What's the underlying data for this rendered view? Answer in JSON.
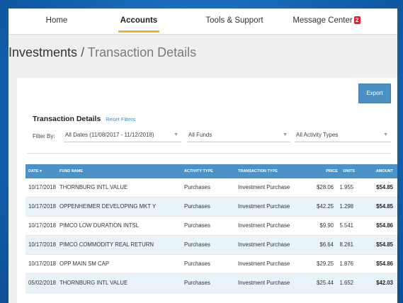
{
  "nav": {
    "items": [
      {
        "label": "Home"
      },
      {
        "label": "Accounts"
      },
      {
        "label": "Tools & Support"
      },
      {
        "label": "Message Center"
      }
    ],
    "message_badge": "2"
  },
  "heading": {
    "section": "Investments",
    "separator": "/",
    "current": "Transaction Details"
  },
  "card": {
    "export_label": "Export",
    "title": "Transaction Details",
    "reset_label": "Reset Filters",
    "filter_label": "Filter By:",
    "filters": {
      "dates": "All Dates (11/08/2017 - 11/12/2018)",
      "funds": "All Funds",
      "activity": "All Activity Types"
    }
  },
  "table": {
    "headers": {
      "date": "DATE",
      "fund": "FUND NAME",
      "activity": "ACTIVITY TYPE",
      "type": "TRANSACTION TYPE",
      "price": "PRICE",
      "units": "UNITS",
      "amount": "AMOUNT"
    },
    "rows": [
      {
        "date": "10/17/2018",
        "fund": "THORNBURG INTL VALUE",
        "activity": "Purchases",
        "type": "Investment Purchase",
        "price": "$28.06",
        "units": "1.955",
        "amount": "$54.85"
      },
      {
        "date": "10/17/2018",
        "fund": "OPPENHEIMER DEVELOPING MKT Y",
        "activity": "Purchases",
        "type": "Investment Purchase",
        "price": "$42.25",
        "units": "1.298",
        "amount": "$54.85"
      },
      {
        "date": "10/17/2018",
        "fund": "PIMCO LOW DURATION INTSL",
        "activity": "Purchases",
        "type": "Investment Purchase",
        "price": "$9.90",
        "units": "5.541",
        "amount": "$54.86"
      },
      {
        "date": "10/17/2018",
        "fund": "PIMCO COMMODITY REAL RETURN",
        "activity": "Purchases",
        "type": "Investment Purchase",
        "price": "$6.64",
        "units": "8.261",
        "amount": "$54.85"
      },
      {
        "date": "10/17/2018",
        "fund": "OPP MAIN SM CAP",
        "activity": "Purchases",
        "type": "Investment Purchase",
        "price": "$29.25",
        "units": "1.876",
        "amount": "$54.86"
      },
      {
        "date": "05/02/2018",
        "fund": "THORNBURG INTL VALUE",
        "activity": "Purchases",
        "type": "Investment Purchase",
        "price": "$25.44",
        "units": "1.652",
        "amount": "$42.03"
      }
    ]
  }
}
